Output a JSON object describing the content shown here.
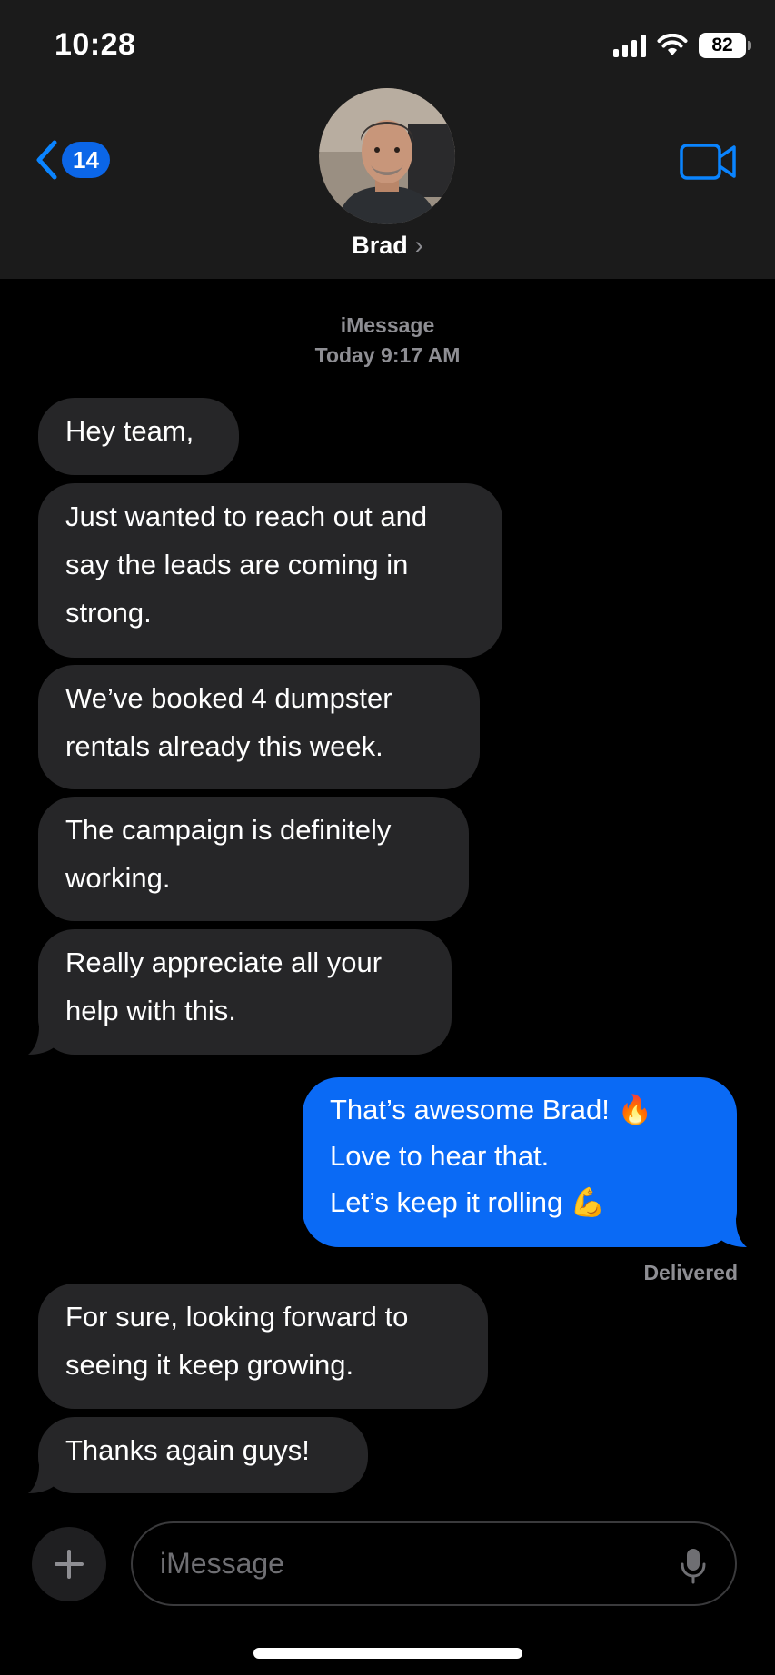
{
  "status_bar": {
    "time": "10:28",
    "battery": "82"
  },
  "nav": {
    "back_badge": "14",
    "contact_name": "Brad",
    "chevron": "›"
  },
  "thread": {
    "service": "iMessage",
    "timestamp": "Today 9:17 AM",
    "messages_incoming_1": [
      "Hey team,",
      "Just wanted to reach out and say the leads are coming in strong.",
      "We’ve booked 4 dumpster rentals already this week.",
      "The campaign is definitely working.",
      "Really appreciate all your help with this."
    ],
    "outgoing": {
      "line1": "That’s awesome Brad! 🔥",
      "line2": "Love to hear that.",
      "line3": "Let’s keep it rolling 💪",
      "status": "Delivered"
    },
    "messages_incoming_2": [
      "For sure, looking forward to seeing it keep growing.",
      "Thanks again guys!"
    ]
  },
  "composer": {
    "placeholder": "iMessage"
  },
  "colors": {
    "accent": "#0a84ff",
    "incoming_bubble": "#262628",
    "outgoing_bubble": "#0a6af5"
  },
  "icons": [
    "back-chevron-icon",
    "video-call-icon",
    "plus-icon",
    "microphone-icon",
    "signal-icon",
    "wifi-icon",
    "battery-icon"
  ]
}
